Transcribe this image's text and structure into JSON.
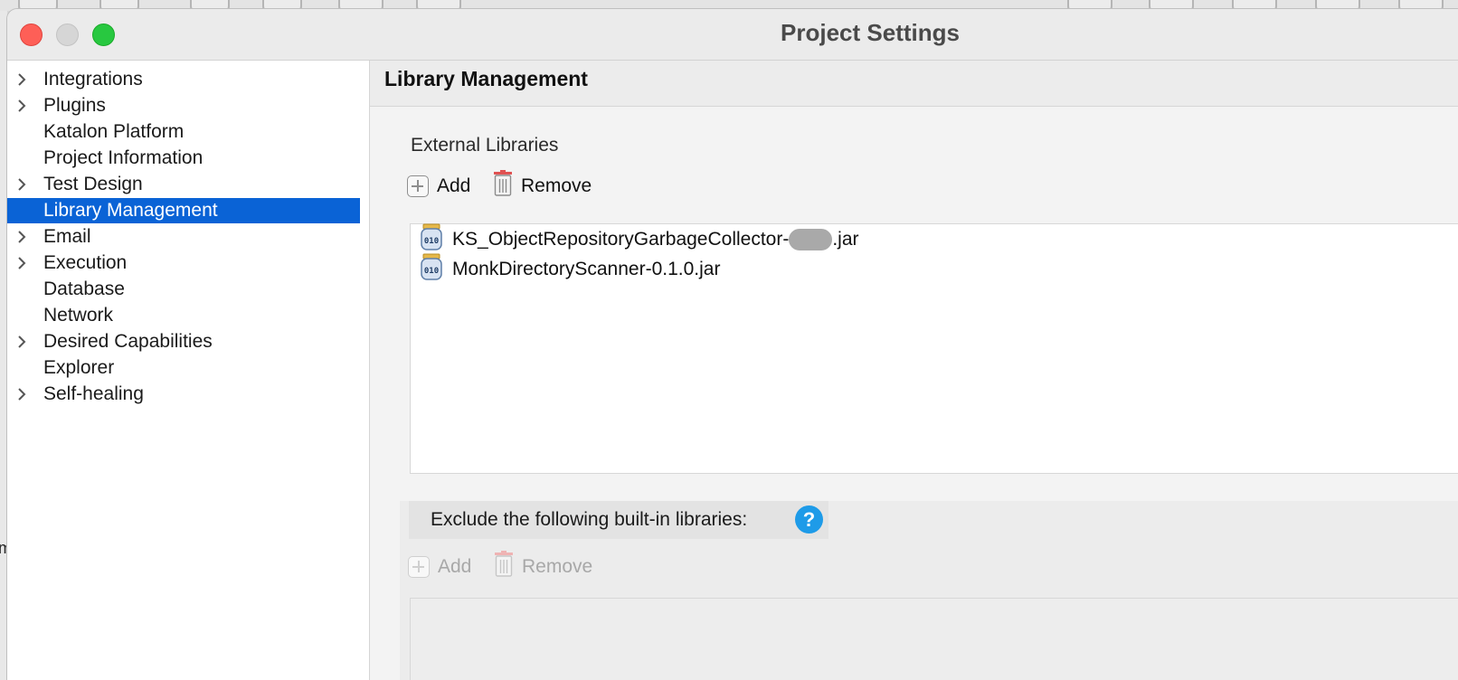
{
  "window": {
    "title": "Project Settings"
  },
  "sidebar": {
    "selected": "Library Management",
    "items": [
      {
        "label": "Integrations",
        "expandable": true
      },
      {
        "label": "Plugins",
        "expandable": true
      },
      {
        "label": "Katalon Platform",
        "expandable": false
      },
      {
        "label": "Project Information",
        "expandable": false
      },
      {
        "label": "Test Design",
        "expandable": true
      },
      {
        "label": "Library Management",
        "expandable": false
      },
      {
        "label": "Email",
        "expandable": true
      },
      {
        "label": "Execution",
        "expandable": true
      },
      {
        "label": "Database",
        "expandable": false
      },
      {
        "label": "Network",
        "expandable": false
      },
      {
        "label": "Desired Capabilities",
        "expandable": true
      },
      {
        "label": "Explorer",
        "expandable": false
      },
      {
        "label": "Self-healing",
        "expandable": true
      }
    ]
  },
  "main": {
    "title": "Library Management",
    "external": {
      "label": "External Libraries",
      "add_label": "Add",
      "remove_label": "Remove",
      "files": [
        {
          "prefix": "KS_ObjectRepositoryGarbageCollector-",
          "suffix": ".jar",
          "redacted": true
        },
        {
          "prefix": "MonkDirectoryScanner-0.1.0.jar",
          "suffix": "",
          "redacted": false
        }
      ]
    },
    "exclude": {
      "label": "Exclude the following built-in libraries:",
      "help_glyph": "?",
      "add_label": "Add",
      "remove_label": "Remove"
    }
  },
  "colors": {
    "selection": "#0a63d6",
    "help_icon": "#1e9be8",
    "close": "#fe5f57",
    "zoom": "#28c840"
  }
}
